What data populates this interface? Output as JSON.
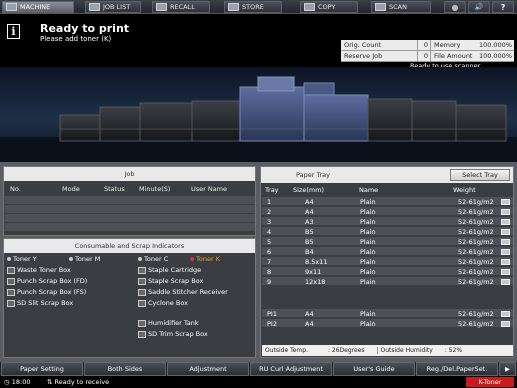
{
  "topbar": {
    "tabs": [
      {
        "label": "MACHINE",
        "icon": "machine-icon",
        "active": true
      },
      {
        "label": "JOB LIST",
        "icon": "list-icon",
        "active": false
      },
      {
        "label": "RECALL",
        "icon": "recall-icon",
        "active": false
      },
      {
        "label": "STORE",
        "icon": "store-icon",
        "active": false
      },
      {
        "label": "COPY",
        "icon": "copy-icon",
        "active": false
      },
      {
        "label": "SCAN",
        "icon": "scan-icon",
        "active": false
      }
    ],
    "buttons": [
      {
        "name": "stop-icon",
        "glyph": "●"
      },
      {
        "name": "volume-icon",
        "glyph": "🔊"
      },
      {
        "name": "help-icon",
        "glyph": "?"
      }
    ]
  },
  "message": {
    "title": "Ready to print",
    "subtitle": "Please add toner (K)"
  },
  "counts": {
    "orig_count_label": "Orig. Count",
    "orig_count_value": "0",
    "memory_label": "Memory",
    "memory_value": "100.000%",
    "reserve_job_label": "Reserve Job",
    "reserve_job_value": "0",
    "file_amount_label": "File Amount",
    "file_amount_value": "100.000%"
  },
  "scanner_status": "Ready to use scanner",
  "job_panel": {
    "title": "Job",
    "columns": [
      "No.",
      "Mode",
      "Status",
      "Minute(S)",
      "User Name"
    ]
  },
  "consumables": {
    "title": "Consumable and Scrap Indicators",
    "left": [
      [
        "Toner Y",
        "Toner M"
      ],
      [
        "Waste Toner Box"
      ],
      [
        "Punch Scrap Box (FD)"
      ],
      [
        "Punch Scrap Box (FS)"
      ],
      [
        "SD Slit Scrap Box"
      ]
    ],
    "right": [
      [
        "Toner C",
        "Toner K"
      ],
      [
        "Staple Cartridge"
      ],
      [
        "Staple Scrap Box"
      ],
      [
        "Saddle Stitcher Receiver"
      ],
      [
        "Cyclone Box"
      ],
      [
        "Humidifier Tank"
      ],
      [
        "SD Trim Scrap Box"
      ]
    ],
    "alert_color": "#f0a020"
  },
  "paper_tray": {
    "title": "Paper Tray",
    "select_label": "Select Tray",
    "columns": [
      "Tray",
      "Size(mm)",
      "Name",
      "Weight"
    ],
    "rows": [
      {
        "tray": "1",
        "size": "A4",
        "name": "Plain",
        "weight": "52-61g/m2"
      },
      {
        "tray": "2",
        "size": "A4",
        "name": "Plain",
        "weight": "52-61g/m2"
      },
      {
        "tray": "3",
        "size": "A3",
        "name": "Plain",
        "weight": "52-61g/m2"
      },
      {
        "tray": "4",
        "size": "B5",
        "name": "Plain",
        "weight": "52-61g/m2"
      },
      {
        "tray": "5",
        "size": "B5",
        "name": "Plain",
        "weight": "52-61g/m2"
      },
      {
        "tray": "6",
        "size": "B4",
        "name": "Plain",
        "weight": "52-61g/m2"
      },
      {
        "tray": "7",
        "size": "8.5x11",
        "name": "Plain",
        "weight": "52-61g/m2"
      },
      {
        "tray": "8",
        "size": "9x11",
        "name": "Plain",
        "weight": "52-61g/m2"
      },
      {
        "tray": "9",
        "size": "12x18",
        "name": "Plain",
        "weight": "52-61g/m2"
      }
    ],
    "pi_rows": [
      {
        "tray": "PI1",
        "size": "A4",
        "name": "Plain",
        "weight": "52-61g/m2"
      },
      {
        "tray": "PI2",
        "size": "A4",
        "name": "Plain",
        "weight": "52-61g/m2"
      }
    ],
    "outside_temp_label": "Outside Temp.",
    "outside_temp_value": ": 26Degrees",
    "outside_humidity_label": "Outside Humidity",
    "outside_humidity_value": ": 52%"
  },
  "function_buttons": [
    "Paper Setting",
    "Both Sides",
    "Adjustment",
    "RU Curl Adjustment",
    "User's Guide",
    "Reg./Del.PaperSet."
  ],
  "statusbar": {
    "time": "18:00",
    "status": "Ready to receive",
    "toner_alert": "K-Toner"
  }
}
